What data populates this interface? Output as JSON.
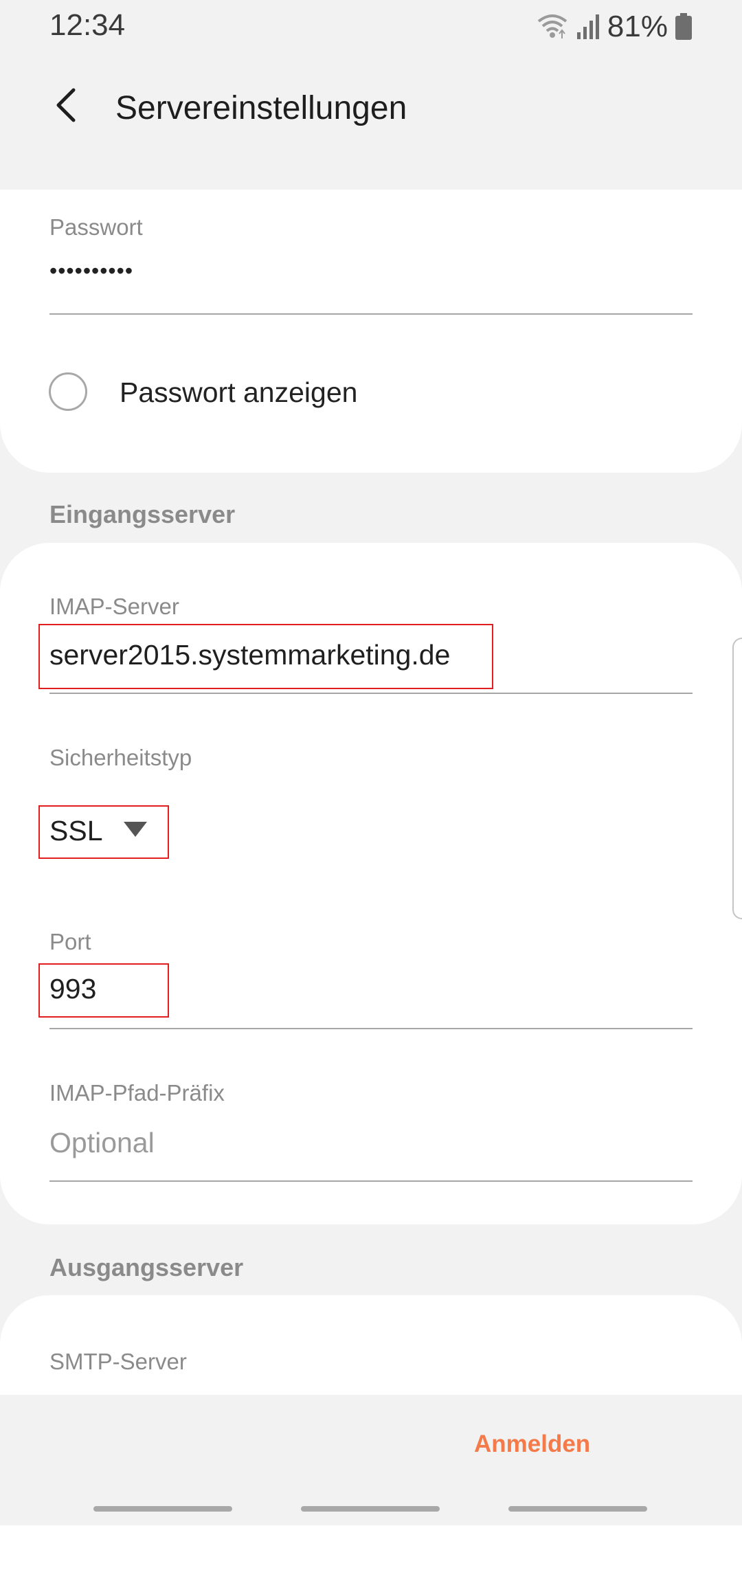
{
  "status_bar": {
    "time": "12:34",
    "battery_percent": "81%"
  },
  "app_bar": {
    "title": "Servereinstellungen"
  },
  "account": {
    "password_label": "Passwort",
    "password_mask": "••••••••••",
    "show_password_label": "Passwort anzeigen"
  },
  "incoming": {
    "section_title": "Eingangsserver",
    "imap_server_label": "IMAP-Server",
    "imap_server_value": "server2015.systemmarketing.de",
    "security_type_label": "Sicherheitstyp",
    "security_type_value": "SSL",
    "port_label": "Port",
    "port_value": "993",
    "path_prefix_label": "IMAP-Pfad-Präfix",
    "path_prefix_placeholder": "Optional"
  },
  "outgoing": {
    "section_title": "Ausgangsserver",
    "smtp_server_label": "SMTP-Server"
  },
  "bottom": {
    "login_button": "Anmelden"
  },
  "colors": {
    "accent": "#f47a4a",
    "highlight": "#e11d1d",
    "background": "#f2f2f2"
  }
}
